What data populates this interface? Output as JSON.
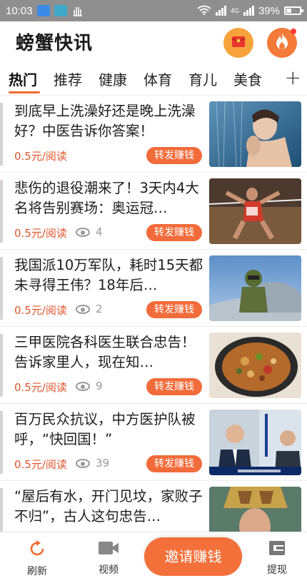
{
  "status_bar": {
    "time": "10:03",
    "network": "4G",
    "battery": "39%",
    "battery_level": 0.39
  },
  "header": {
    "title": "螃蟹快讯"
  },
  "tabs": [
    {
      "label": "热门",
      "active": true
    },
    {
      "label": "推荐"
    },
    {
      "label": "健康"
    },
    {
      "label": "体育"
    },
    {
      "label": "育儿"
    },
    {
      "label": "美食"
    }
  ],
  "tab_add": "+",
  "articles": [
    {
      "title": "到底早上洗澡好还是晚上洗澡好？中医告诉你答案！",
      "reward": "0.5元/阅读",
      "views": "",
      "share_label": "转发赚钱"
    },
    {
      "title": "悲伤的退役潮来了！3天内4大名将告别赛场：奥运冠…",
      "reward": "0.5元/阅读",
      "views": "4",
      "share_label": "转发赚钱"
    },
    {
      "title": "我国派10万军队，耗时15天都未寻得王伟？18年后…",
      "reward": "0.5元/阅读",
      "views": "2",
      "share_label": "转发赚钱"
    },
    {
      "title": "三甲医院各科医生联合忠告！告诉家里人，现在知…",
      "reward": "0.5元/阅读",
      "views": "9",
      "share_label": "转发赚钱"
    },
    {
      "title": "百万民众抗议，中方医护队被呼，“快回国！”",
      "reward": "0.5元/阅读",
      "views": "39",
      "share_label": "转发赚钱"
    },
    {
      "title": "“屋后有水，开门见坟，家败子不归”，古人这句忠告…",
      "reward": "",
      "views": "",
      "share_label": ""
    }
  ],
  "bottom_nav": {
    "refresh": "刷新",
    "video": "视频",
    "invite": "邀请赚钱",
    "withdraw": "提现"
  }
}
